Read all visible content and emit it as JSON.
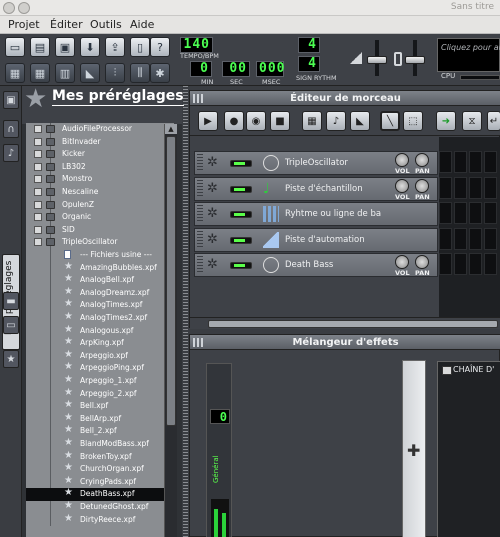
{
  "window": {
    "title": "Sans titre"
  },
  "menu": [
    "Projet",
    "Éditer",
    "Outils",
    "Aide"
  ],
  "tempo": {
    "value": "140",
    "label": "TEMPO/BPM"
  },
  "time": {
    "min": "0",
    "sec": "00",
    "msec": "000",
    "min_label": "MIN",
    "sec_label": "SEC",
    "msec_label": "MSEC"
  },
  "signature": {
    "top": "4",
    "bottom": "4",
    "label": "SIGN RYTHM"
  },
  "cpu": {
    "hint": "Cliquez pour any",
    "label": "CPU"
  },
  "sidebar": {
    "vertical_tab": "Mes préréglages"
  },
  "presets": {
    "title": "Mes préréglages",
    "folders": [
      "AudioFileProcessor",
      "BitInvader",
      "Kicker",
      "LB302",
      "Monstro",
      "Nescaline",
      "OpulenZ",
      "Organic",
      "SID",
      "TripleOscillator"
    ],
    "factory_label": "--- Fichiers usine ---",
    "files": [
      "AmazingBubbles.xpf",
      "AnalogBell.xpf",
      "AnalogDreamz.xpf",
      "AnalogTimes.xpf",
      "AnalogTimes2.xpf",
      "Analogous.xpf",
      "ArpKing.xpf",
      "Arpeggio.xpf",
      "ArpeggioPing.xpf",
      "Arpeggio_1.xpf",
      "Arpeggio_2.xpf",
      "Bell.xpf",
      "BellArp.xpf",
      "Bell_2.xpf",
      "BlandModBass.xpf",
      "BrokenToy.xpf",
      "ChurchOrgan.xpf",
      "CryingPads.xpf",
      "DeathBass.xpf",
      "DetunedGhost.xpf",
      "DirtyReece.xpf"
    ],
    "selected": "DeathBass.xpf"
  },
  "song_editor": {
    "title": "Éditeur de morceau",
    "tracks": [
      {
        "name": "TripleOscillator",
        "knobs": true,
        "icon": "oscillator-icon"
      },
      {
        "name": "Piste d'échantillon",
        "knobs": true,
        "icon": "sample-note-icon"
      },
      {
        "name": "Ryhtme ou ligne de ba",
        "knobs": false,
        "icon": "beat-grid-icon"
      },
      {
        "name": "Piste d'automation",
        "knobs": false,
        "icon": "automation-icon"
      },
      {
        "name": "Death Bass",
        "knobs": true,
        "icon": "oscillator-icon"
      }
    ],
    "vol_label": "VOL",
    "pan_label": "PAN"
  },
  "mixer": {
    "title": "Mélangeur d'effets",
    "channel_number": "0",
    "channel_name": "Général",
    "chain_label": "CHAÎNE D'"
  }
}
